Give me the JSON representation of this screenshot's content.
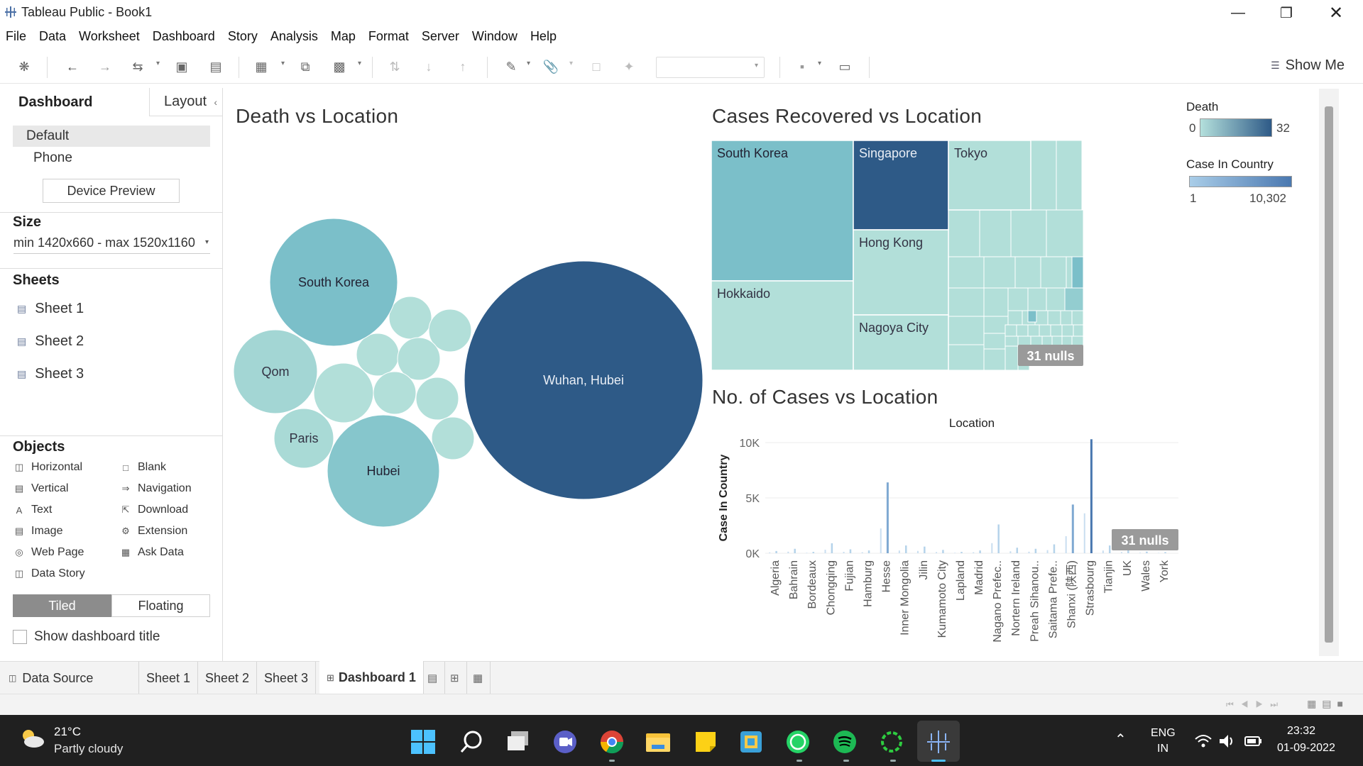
{
  "window": {
    "title": "Tableau Public - Book1"
  },
  "menu": [
    "File",
    "Data",
    "Worksheet",
    "Dashboard",
    "Story",
    "Analysis",
    "Map",
    "Format",
    "Server",
    "Window",
    "Help"
  ],
  "toolbar": {
    "show_me": "Show Me"
  },
  "left_panel": {
    "tabs": {
      "dashboard": "Dashboard",
      "layout": "Layout"
    },
    "device": {
      "default": "Default",
      "phone": "Phone",
      "preview_button": "Device Preview"
    },
    "size": {
      "title": "Size",
      "value": "min 1420x660 - max 1520x1160"
    },
    "sheets": {
      "title": "Sheets",
      "items": [
        "Sheet 1",
        "Sheet 2",
        "Sheet 3"
      ]
    },
    "objects": {
      "title": "Objects",
      "items": [
        "Horizontal",
        "Blank",
        "Vertical",
        "Navigation",
        "Text",
        "Download",
        "Image",
        "Extension",
        "Web Page",
        "Ask Data",
        "Data Story"
      ]
    },
    "tiled": "Tiled",
    "floating": "Floating",
    "show_title": "Show dashboard title"
  },
  "dashboard": {
    "bubble_title": "Death vs Location",
    "treemap_title": "Cases Recovered vs Location",
    "bar_title": "No. of Cases vs Location",
    "legend_death": {
      "title": "Death",
      "min": "0",
      "max": "32",
      "color_low": "#b4e0dc",
      "color_high": "#2e5a87"
    },
    "legend_cases": {
      "title": "Case In Country",
      "min": "1",
      "max": "10,302",
      "color_low": "#a9cde8",
      "color_high": "#4a78b0"
    }
  },
  "chart_data": [
    {
      "type": "bubble",
      "title": "Death vs Location",
      "labels": [
        "Wuhan, Hubei",
        "South Korea",
        "Hubei",
        "Qom",
        "Paris"
      ]
    },
    {
      "type": "treemap",
      "title": "Cases Recovered vs Location",
      "labels": [
        "South Korea",
        "Singapore",
        "Tokyo",
        "Hokkaido",
        "Hong Kong",
        "Nagoya City"
      ],
      "nulls_label": "31 nulls"
    },
    {
      "type": "bar",
      "title": "No. of Cases vs Location",
      "xlabel": "Location",
      "ylabel": "Case In Country",
      "ylim": [
        0,
        10000
      ],
      "yticks": [
        "10K",
        "5K",
        "0K"
      ],
      "categories": [
        "Algeria",
        "Bahrain",
        "Bordeaux",
        "Chongqing",
        "Fujian",
        "Hamburg",
        "Hesse",
        "Inner Mongolia",
        "Jilin",
        "Kumamoto City",
        "Lapland",
        "Madrid",
        "Nagano Prefec..",
        "Nortern Ireland",
        "Preah Sihanou..",
        "Saitama Prefe..",
        "Shanxi (陕西)",
        "Strasbourg",
        "Tianjin",
        "UK",
        "Wales",
        "York"
      ],
      "values": [
        200,
        400,
        120,
        900,
        350,
        250,
        6400,
        700,
        600,
        300,
        120,
        250,
        2600,
        500,
        400,
        800,
        4400,
        10302,
        700,
        300,
        150,
        100
      ],
      "nulls_label": "31 nulls"
    }
  ],
  "sheet_tabs": {
    "data_source": "Data Source",
    "items": [
      "Sheet 1",
      "Sheet 2",
      "Sheet 3"
    ],
    "active": "Dashboard 1"
  },
  "taskbar": {
    "weather_temp": "21°C",
    "weather_desc": "Partly cloudy",
    "lang1": "ENG",
    "lang2": "IN",
    "time": "23:32",
    "date": "01-09-2022"
  }
}
